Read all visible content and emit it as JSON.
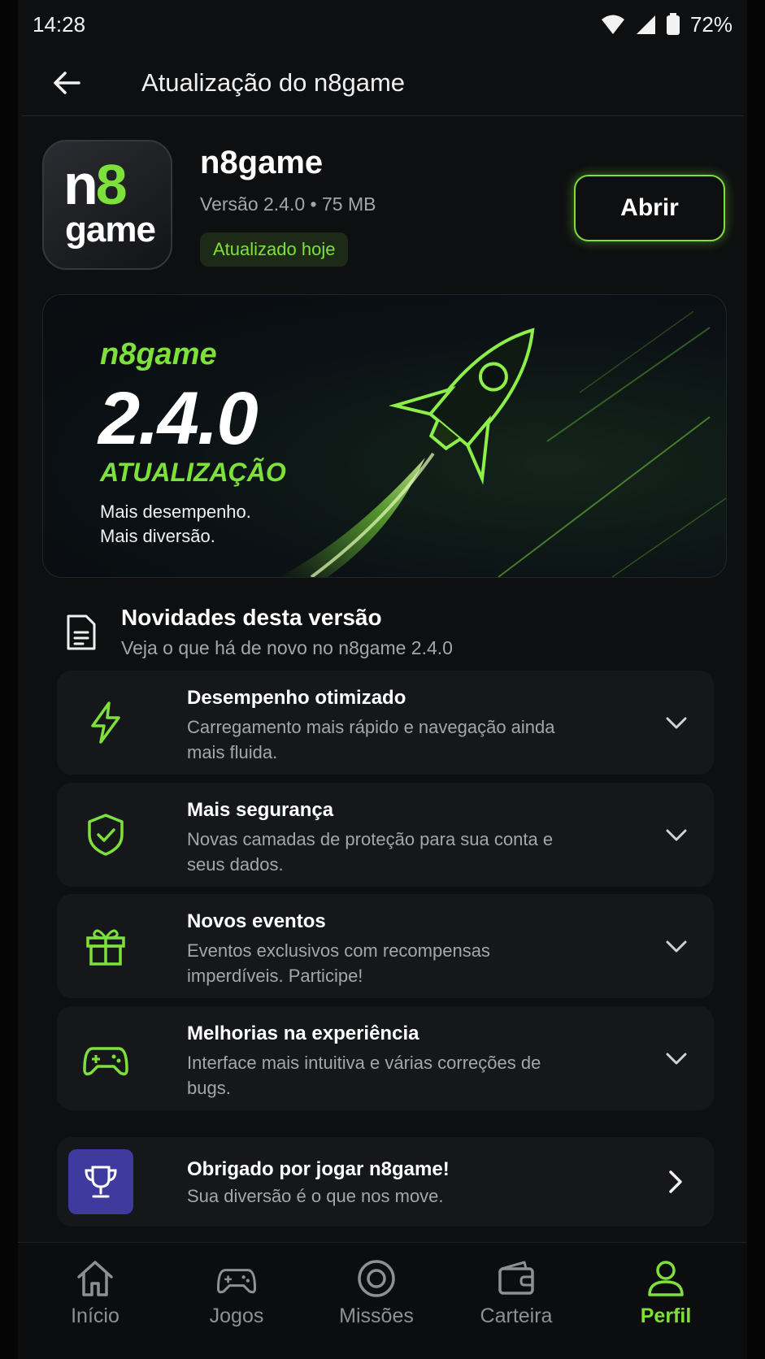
{
  "status_bar": {
    "time": "14:28",
    "battery": "72%"
  },
  "app_bar": {
    "title": "Atualização do n8game"
  },
  "app": {
    "icon_top": "n8",
    "icon_bottom": "game",
    "name": "n8game",
    "meta": "Versão 2.4.0 • 75 MB",
    "badge": "Atualizado hoje",
    "open_label": "Abrir"
  },
  "banner": {
    "brand": "n8game",
    "version": "2.4.0",
    "headline": "ATUALIZAÇÃO",
    "line1": "Mais desempenho.",
    "line2": "Mais diversão."
  },
  "whats_new": {
    "title": "Novidades desta versão",
    "subtitle": "Veja o que há de novo no n8game 2.4.0",
    "items": [
      {
        "icon": "lightning-icon",
        "title": "Desempenho otimizado",
        "description": "Carregamento mais rápido e navegação ainda mais fluida."
      },
      {
        "icon": "shield-check-icon",
        "title": "Mais segurança",
        "description": "Novas camadas de proteção para sua conta e seus dados."
      },
      {
        "icon": "gift-icon",
        "title": "Novos eventos",
        "description": "Eventos exclusivos com recompensas imperdíveis. Participe!"
      },
      {
        "icon": "gamepad-icon",
        "title": "Melhorias na experiência",
        "description": "Interface mais intuitiva e várias correções de bugs."
      }
    ]
  },
  "thanks": {
    "title": "Obrigado por jogar n8game!",
    "subtitle": "Sua diversão é o que nos move."
  },
  "bottom_nav": {
    "active": "Perfil",
    "items": [
      {
        "label": "Início",
        "icon": "home-icon"
      },
      {
        "label": "Jogos",
        "icon": "gamepad-icon"
      },
      {
        "label": "Missões",
        "icon": "target-icon"
      },
      {
        "label": "Carteira",
        "icon": "wallet-icon"
      },
      {
        "label": "Perfil",
        "icon": "user-icon"
      }
    ]
  },
  "colors": {
    "accent": "#7ee03a",
    "background": "#0e0f11",
    "card": "#15171a",
    "trophy": "#3f3a9e"
  }
}
